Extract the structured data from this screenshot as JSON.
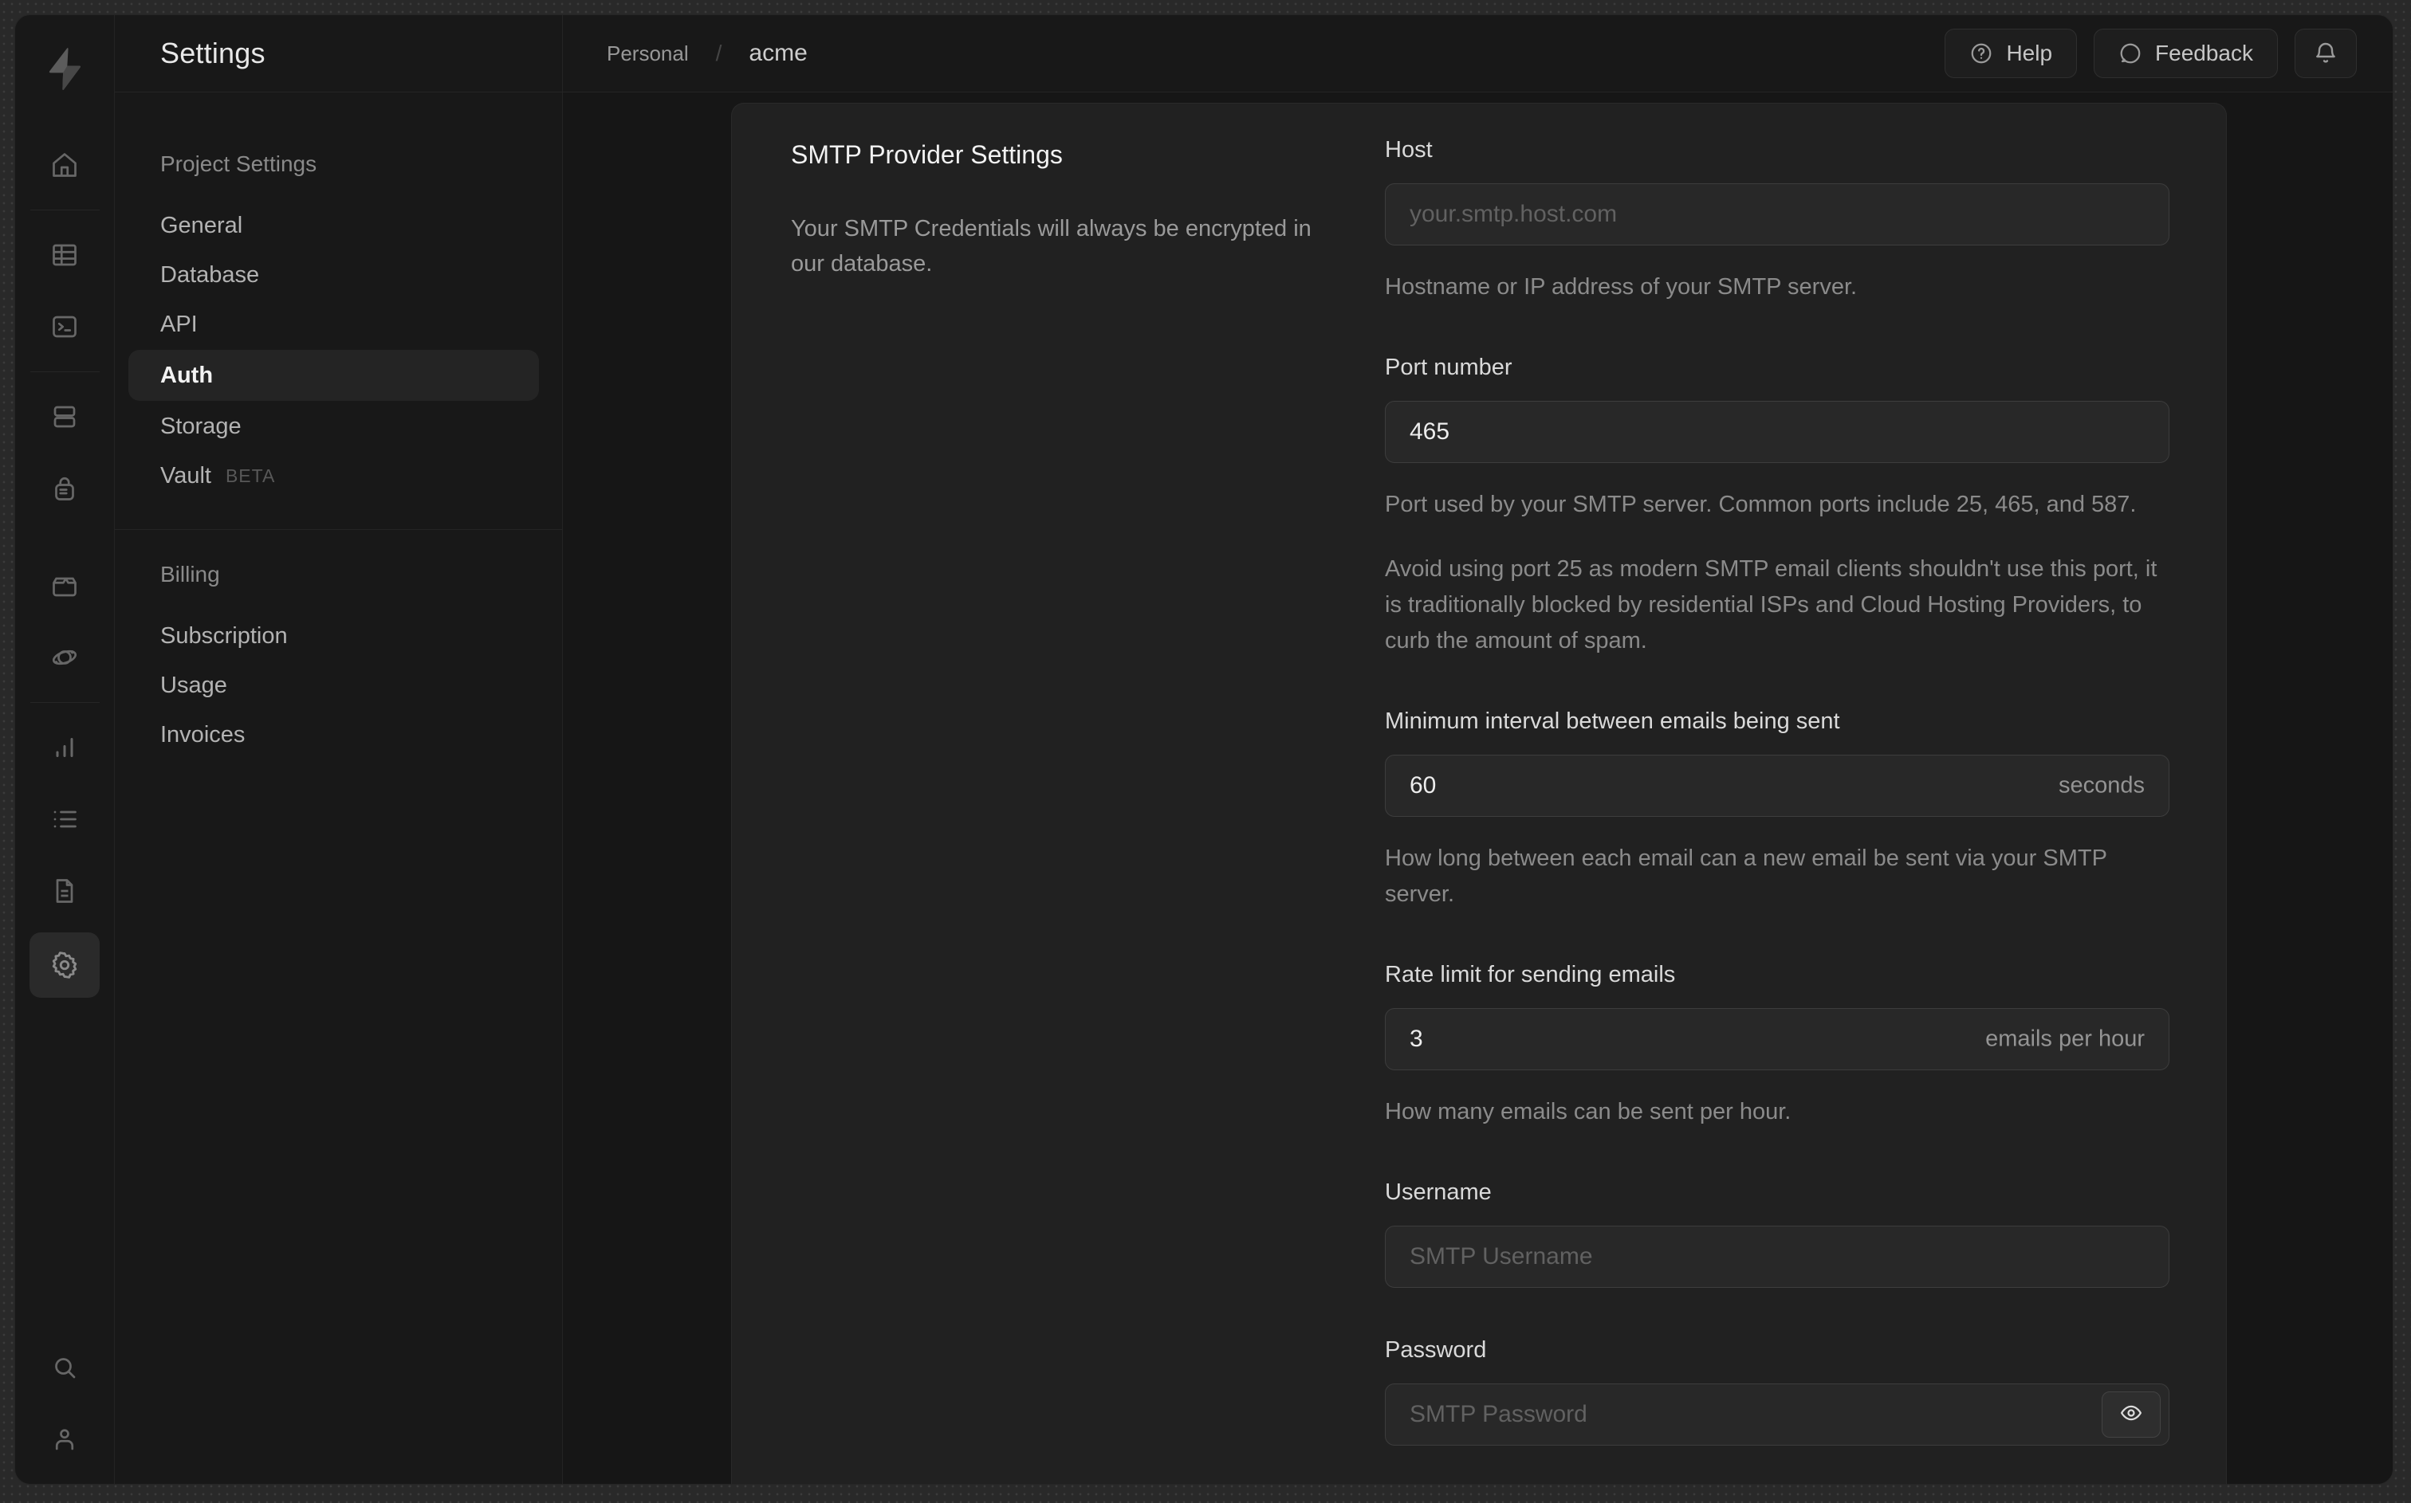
{
  "header": {
    "title": "Settings",
    "breadcrumb": {
      "org": "Personal",
      "separator": "/",
      "project": "acme"
    },
    "actions": {
      "help": "Help",
      "feedback": "Feedback",
      "bell_icon": "bell-icon"
    }
  },
  "rail": {
    "logo_icon": "supabase-bolt-logo",
    "items": [
      "home",
      "table-editor",
      "sql-editor",
      "database",
      "authentication",
      "storage",
      "edge-functions",
      "reports",
      "logs",
      "api-docs",
      "project-settings"
    ],
    "active_item": "project-settings",
    "bottom_items": [
      "search",
      "account"
    ]
  },
  "sidebar": {
    "sections": [
      {
        "label": "Project Settings",
        "items": [
          {
            "label": "General"
          },
          {
            "label": "Database"
          },
          {
            "label": "API"
          },
          {
            "label": "Auth",
            "active": true
          },
          {
            "label": "Storage"
          },
          {
            "label": "Vault",
            "badge": "BETA"
          }
        ]
      },
      {
        "label": "Billing",
        "items": [
          {
            "label": "Subscription"
          },
          {
            "label": "Usage"
          },
          {
            "label": "Invoices"
          }
        ]
      }
    ]
  },
  "panel": {
    "title": "SMTP Provider Settings",
    "description": "Your SMTP Credentials will always be encrypted in our database.",
    "fields": [
      {
        "label": "Host",
        "placeholder": "your.smtp.host.com",
        "helper": "Hostname or IP address of your SMTP server."
      },
      {
        "label": "Port number",
        "value": "465",
        "helper": "Port used by your SMTP server. Common ports include 25, 465, and 587.",
        "note": "Avoid using port 25 as modern SMTP email clients shouldn't use this port, it is traditionally blocked by residential ISPs and Cloud Hosting Providers, to curb the amount of spam."
      },
      {
        "label": "Minimum interval between emails being sent",
        "value": "60",
        "suffix": "seconds",
        "helper": "How long between each email can a new email be sent via your SMTP server."
      },
      {
        "label": "Rate limit for sending emails",
        "value": "3",
        "suffix": "emails per hour",
        "helper": "How many emails can be sent per hour."
      },
      {
        "label": "Username",
        "placeholder": "SMTP Username"
      },
      {
        "label": "Password",
        "placeholder": "SMTP Password",
        "toggle_icon": "eye-icon"
      }
    ]
  },
  "colors": {
    "outer_background": "#292929",
    "window_background": "#181818",
    "panel_background": "#212121",
    "divider": "#242424",
    "input_background": "#282828",
    "input_border": "#3d3d3d",
    "text_primary": "#ededed",
    "text_muted": "#8b8b8b",
    "text_placeholder": "#616161"
  }
}
